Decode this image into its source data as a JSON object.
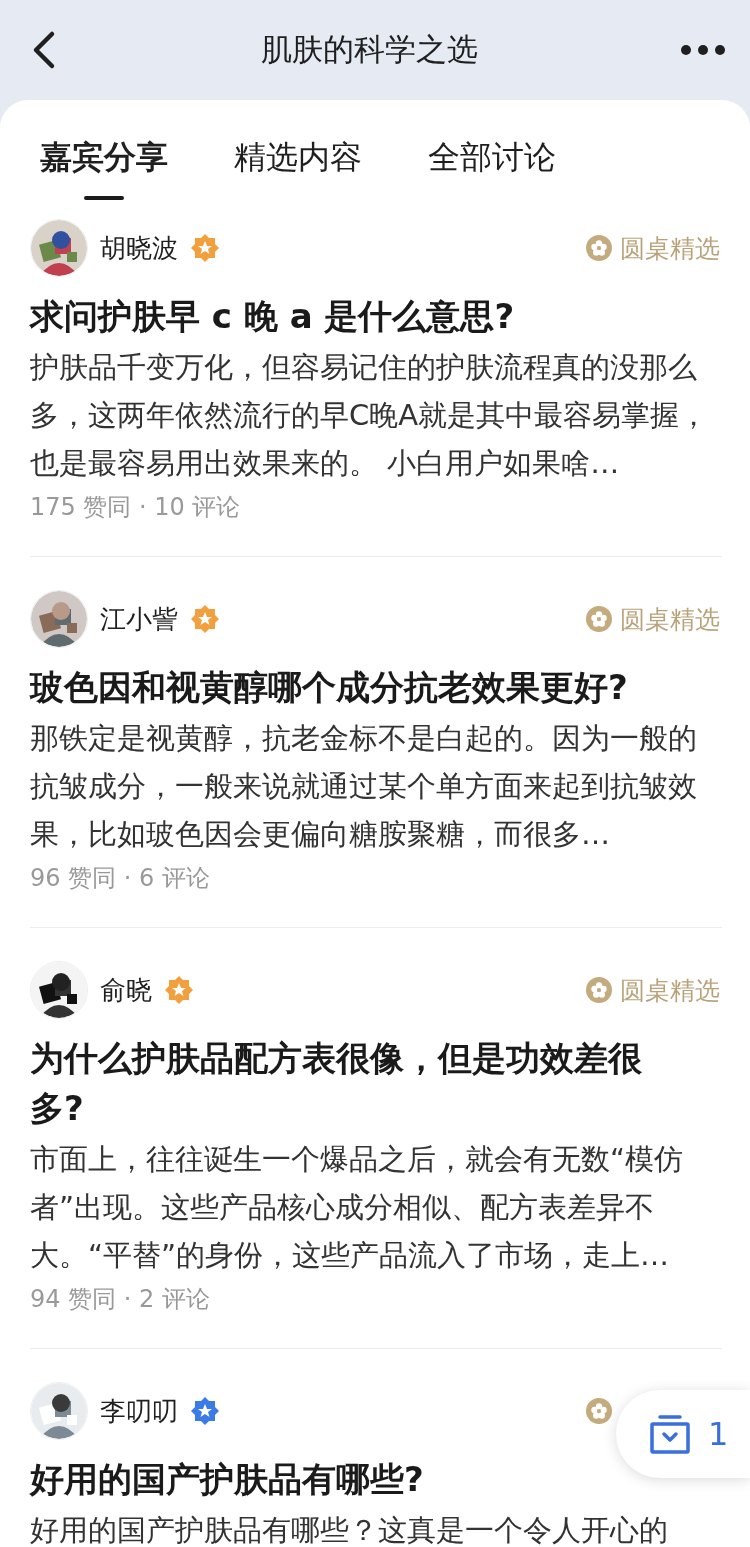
{
  "header": {
    "title": "肌肤的科学之选"
  },
  "tabs": [
    {
      "label": "嘉宾分享",
      "selected": true
    },
    {
      "label": "精选内容",
      "selected": false
    },
    {
      "label": "全部讨论",
      "selected": false
    }
  ],
  "posts": [
    {
      "author": "胡晓波",
      "color": "#f2a03d",
      "badge_label": "圆桌精选",
      "title": "求问护肤早 c 晚 a 是什么意思?",
      "excerpt": "护肤品千变万化，但容易记住的护肤流程真的没那么多，这两年依然流行的早C晚A就是其中最容易掌握，也是最容易用出效果来的。 小白用户如果啥…",
      "stats": "175 赞同 · 10 评论"
    },
    {
      "author": "江小訾",
      "color": "#f2a03d",
      "badge_label": "圆桌精选",
      "title": "玻色因和视黄醇哪个成分抗老效果更好?",
      "excerpt": "那铁定是视黄醇，抗老金标不是白起的。因为一般的抗皱成分，一般来说就通过某个单方面来起到抗皱效果，比如玻色因会更偏向糖胺聚糖，而很多…",
      "stats": "96 赞同 · 6 评论"
    },
    {
      "author": "俞晓",
      "color": "#f2a03d",
      "badge_label": "圆桌精选",
      "title": "为什么护肤品配方表很像，但是功效差很多?",
      "excerpt": "市面上，往往诞生一个爆品之后，就会有无数“模仿者”出现。这些产品核心成分相似、配方表差异不大。“平替”的身份，这些产品流入了市场，走上…",
      "stats": "94 赞同 · 2 评论"
    },
    {
      "author": "李叨叨",
      "color": "#3b7be8",
      "title": "好用的国产护肤品有哪些?",
      "excerpt": "好用的国产护肤品有哪些？这真是一个令人开心的"
    }
  ],
  "float_button": {
    "count": "1"
  }
}
